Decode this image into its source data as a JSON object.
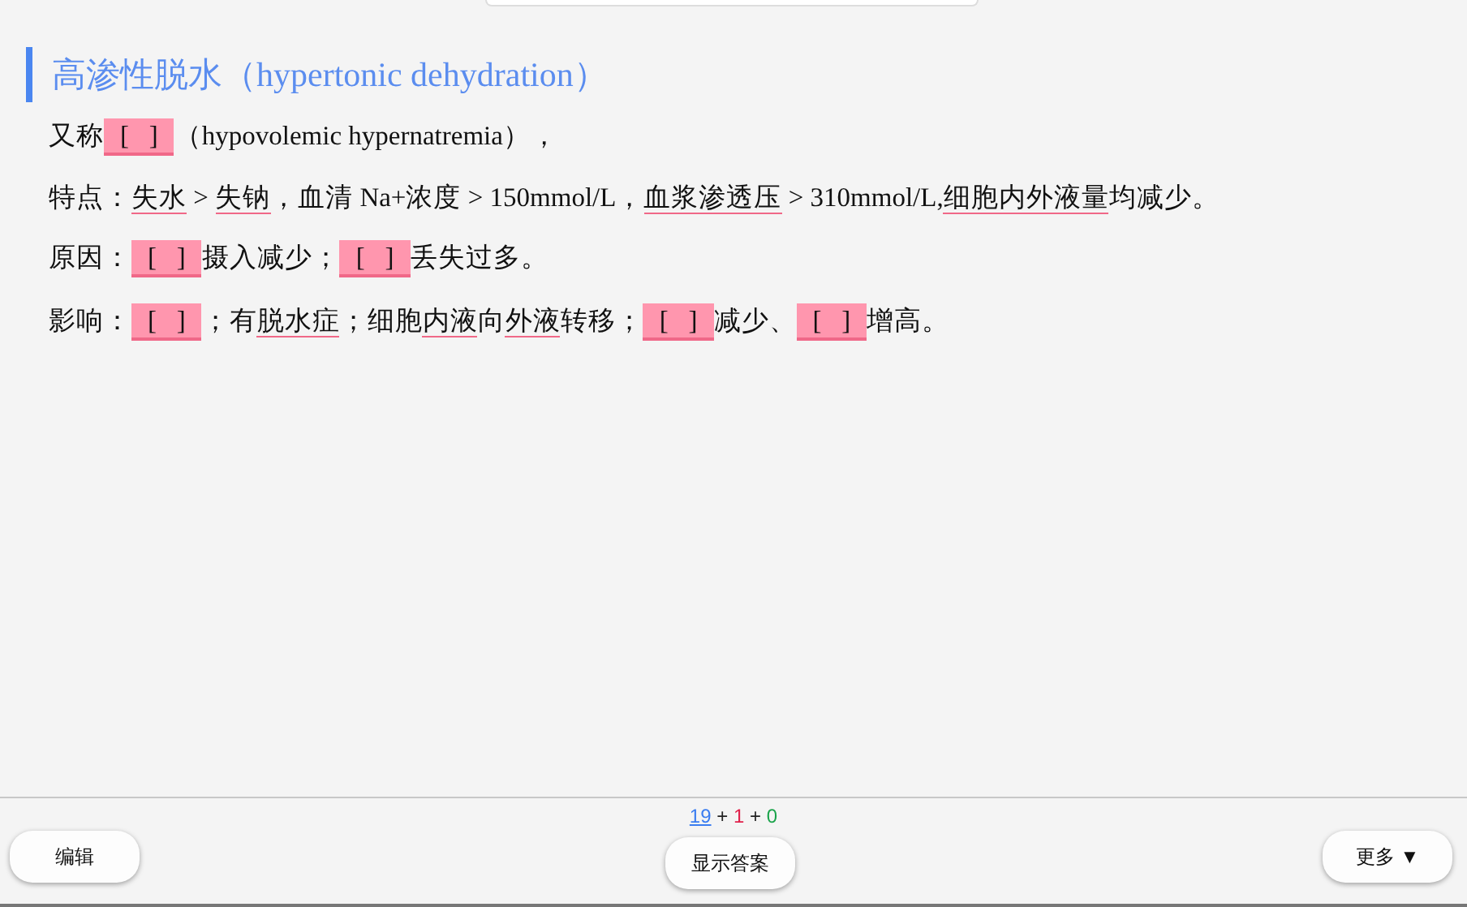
{
  "heading": "高渗性脱水（hypertonic dehydration）",
  "lines": [
    [
      {
        "kind": "text",
        "text": "又称"
      },
      {
        "kind": "cloze",
        "text": "[   ]"
      },
      {
        "kind": "text",
        "text": "（hypovolemic hypernatremia），"
      }
    ],
    [
      {
        "kind": "text",
        "text": "特点："
      },
      {
        "kind": "term",
        "text": "失水"
      },
      {
        "kind": "text",
        "text": " > "
      },
      {
        "kind": "term",
        "text": "失钠"
      },
      {
        "kind": "text",
        "text": "，血清 Na+浓度 > 150mmol/L，"
      },
      {
        "kind": "term",
        "text": "血浆渗透压"
      },
      {
        "kind": "text",
        "text": " > 310mmol/L,"
      },
      {
        "kind": "term",
        "text": "细胞内外液量"
      },
      {
        "kind": "text",
        "text": "均减少。"
      }
    ],
    [
      {
        "kind": "text",
        "text": "原因："
      },
      {
        "kind": "cloze",
        "text": "[   ]"
      },
      {
        "kind": "text",
        "text": "摄入减少；"
      },
      {
        "kind": "cloze",
        "text": "[   ]"
      },
      {
        "kind": "text",
        "text": "丢失过多。"
      }
    ],
    [
      {
        "kind": "text",
        "text": "影响："
      },
      {
        "kind": "cloze",
        "text": "[   ]"
      },
      {
        "kind": "text",
        "text": "；有"
      },
      {
        "kind": "term",
        "text": "脱水症"
      },
      {
        "kind": "text",
        "text": "；细胞"
      },
      {
        "kind": "term",
        "text": "内液"
      },
      {
        "kind": "text",
        "text": "向"
      },
      {
        "kind": "term",
        "text": "外液"
      },
      {
        "kind": "text",
        "text": "转移；"
      },
      {
        "kind": "cloze",
        "text": "[   ]"
      },
      {
        "kind": "text",
        "text": "减少、"
      },
      {
        "kind": "cloze",
        "text": "[   ]"
      },
      {
        "kind": "text",
        "text": "增高。"
      }
    ]
  ],
  "footer": {
    "counts": [
      {
        "kind": "new",
        "text": "19"
      },
      {
        "kind": "sep",
        "text": "+"
      },
      {
        "kind": "learn",
        "text": "1"
      },
      {
        "kind": "sep",
        "text": "+"
      },
      {
        "kind": "review",
        "text": "0"
      }
    ],
    "left_button": "编辑",
    "center_button": "显示答案",
    "right_button": "更多 ▼"
  }
}
